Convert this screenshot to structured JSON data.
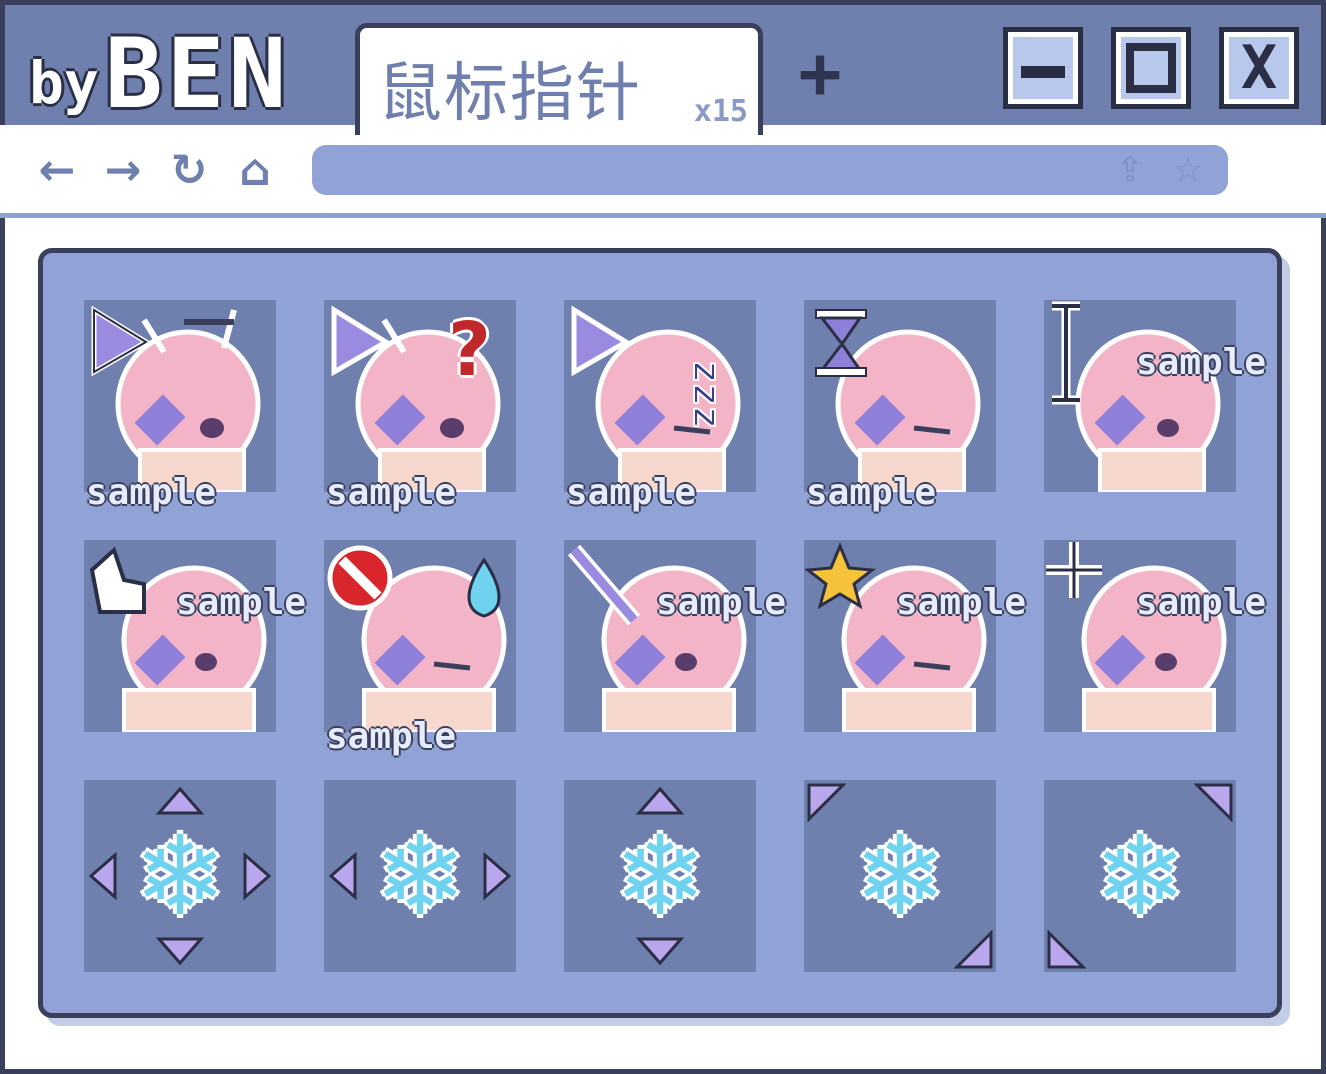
{
  "brand": {
    "by": "by",
    "name": "BEN"
  },
  "tab": {
    "label": "鼠标指针",
    "count": "x15"
  },
  "newtab": {
    "label": "+"
  },
  "window_controls": {
    "close_glyph": "X"
  },
  "nav": {
    "back_icon": "←",
    "forward_icon": "→",
    "reload_icon": "↻",
    "home_icon": "⌂",
    "share_icon": "⇪",
    "bookmark_icon": "☆"
  },
  "cursors": {
    "sample_text": "sample",
    "snow_glyph": "❄",
    "help_glyph": "?"
  },
  "colors": {
    "frame": "#3a3f5c",
    "titlebar": "#6f7fae",
    "panel": "#91a3d6",
    "cell": "#6f7fae",
    "accent_purple": "#b9a6ec",
    "snow": "#6fd3f0"
  }
}
